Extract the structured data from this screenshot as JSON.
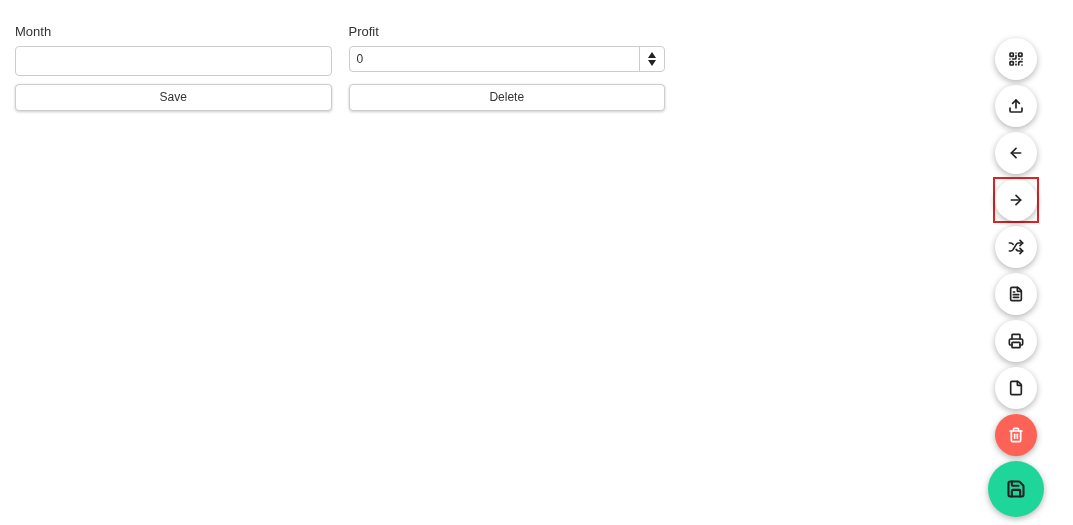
{
  "form": {
    "fields": [
      {
        "label": "Month",
        "kind": "text"
      },
      {
        "label": "Profit",
        "kind": "number",
        "value": "0"
      }
    ],
    "buttons": [
      "Save",
      "Delete"
    ]
  },
  "fab": [
    {
      "kind": "qrcode",
      "color": "#ffffff",
      "highlighted": false
    },
    {
      "kind": "upload",
      "color": "#ffffff",
      "highlighted": false
    },
    {
      "kind": "back",
      "color": "#ffffff",
      "highlighted": false
    },
    {
      "kind": "forward",
      "color": "#ffffff",
      "highlighted": true
    },
    {
      "kind": "shuffle",
      "color": "#ffffff",
      "highlighted": false
    },
    {
      "kind": "document",
      "color": "#ffffff",
      "highlighted": false
    },
    {
      "kind": "print",
      "color": "#ffffff",
      "highlighted": false
    },
    {
      "kind": "blank",
      "color": "#ffffff",
      "highlighted": false
    },
    {
      "kind": "delete",
      "color": "#fd6257",
      "highlighted": false
    },
    {
      "kind": "save",
      "color": "#1fd69a",
      "highlighted": false
    }
  ]
}
